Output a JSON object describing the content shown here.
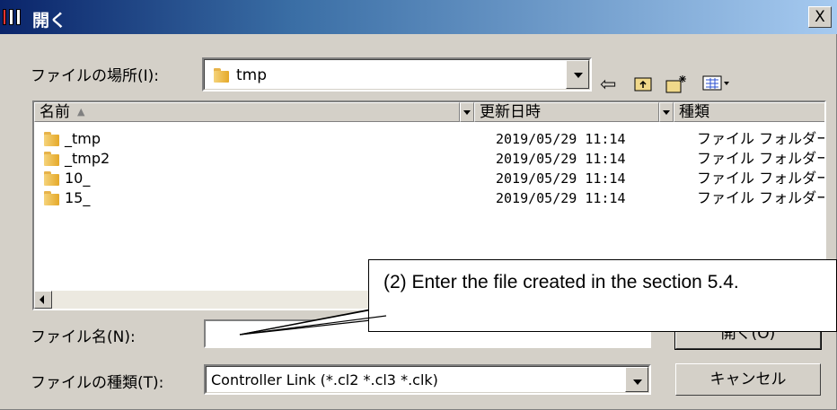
{
  "window": {
    "title": "開く",
    "close_label": "X"
  },
  "look_in": {
    "label": "ファイルの場所(I):",
    "value": "tmp",
    "icon": "folder-icon"
  },
  "toolbar": {
    "icons": [
      "back-arrow-icon",
      "up-folder-icon",
      "new-folder-icon",
      "view-menu-icon"
    ]
  },
  "list": {
    "columns": [
      "名前",
      "更新日時",
      "種類"
    ],
    "sort_column": "名前",
    "rows": [
      {
        "name": "_tmp",
        "modified": "2019/05/29 11:14",
        "type": "ファイル フォルダー"
      },
      {
        "name": "_tmp2",
        "modified": "2019/05/29 11:14",
        "type": "ファイル フォルダー"
      },
      {
        "name": "10_",
        "modified": "2019/05/29 11:14",
        "type": "ファイル フォルダー"
      },
      {
        "name": "15_",
        "modified": "2019/05/29 11:14",
        "type": "ファイル フォルダー"
      }
    ]
  },
  "file_name": {
    "label": "ファイル名(N):",
    "value": ""
  },
  "file_type": {
    "label": "ファイルの種類(T):",
    "value": "Controller Link (*.cl2 *.cl3 *.clk)"
  },
  "buttons": {
    "open": "開く(O)",
    "cancel": "キャンセル"
  },
  "annotation": {
    "text": "(2) Enter the file created in the section 5.4."
  }
}
